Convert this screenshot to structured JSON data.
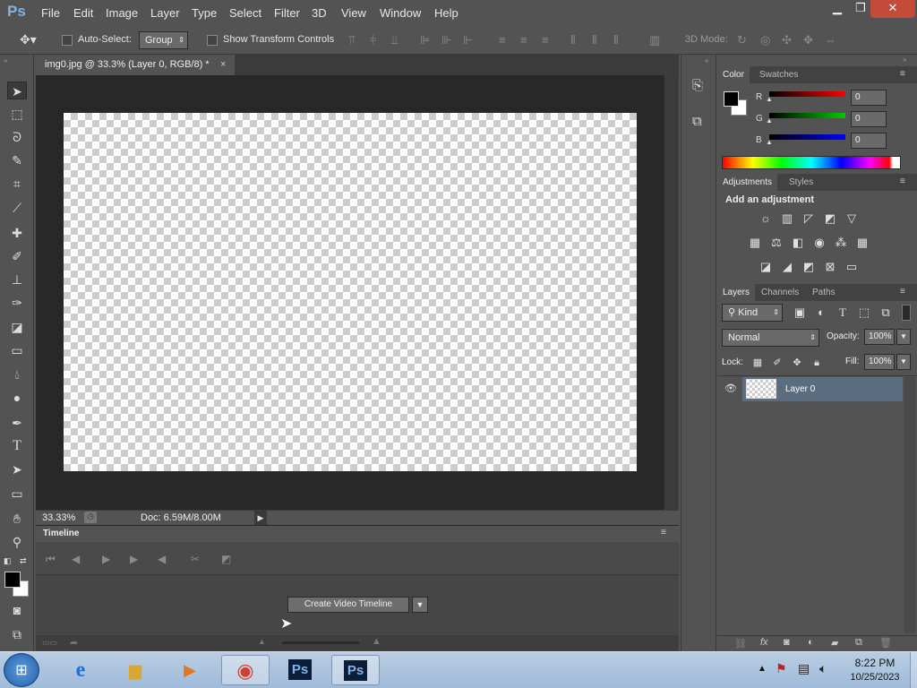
{
  "app": {
    "logo": "Ps",
    "window_controls": {
      "minimize": "▁",
      "restore": "❐",
      "close": "✕"
    }
  },
  "menu": [
    "File",
    "Edit",
    "Image",
    "Layer",
    "Type",
    "Select",
    "Filter",
    "3D",
    "View",
    "Window",
    "Help"
  ],
  "options_bar": {
    "auto_select_label": "Auto-Select:",
    "auto_select_value": "Group",
    "show_transform_label": "Show Transform Controls",
    "mode_3d_label": "3D Mode:"
  },
  "document": {
    "tab_title": "img0.jpg @ 33.3% (Layer 0, RGB/8) *",
    "tab_close": "×",
    "zoom": "33.33%",
    "doc_info": "Doc: 6.59M/8.00M"
  },
  "timeline": {
    "title": "Timeline",
    "create_button": "Create Video Timeline"
  },
  "color_panel": {
    "tabs": [
      "Color",
      "Swatches"
    ],
    "r_label": "R",
    "g_label": "G",
    "b_label": "B",
    "r": "0",
    "g": "0",
    "b": "0"
  },
  "adjustments_panel": {
    "tabs": [
      "Adjustments",
      "Styles"
    ],
    "heading": "Add an adjustment"
  },
  "layers_panel": {
    "tabs": [
      "Layers",
      "Channels",
      "Paths"
    ],
    "filter_kind": "Kind",
    "blend_mode": "Normal",
    "opacity_label": "Opacity:",
    "opacity": "100%",
    "lock_label": "Lock:",
    "fill_label": "Fill:",
    "fill": "100%",
    "layers": [
      {
        "name": "Layer 0"
      }
    ]
  },
  "taskbar": {
    "time": "8:22 PM",
    "date": "10/25/2023"
  },
  "colors": {
    "panel": "#535353",
    "canvas_bg": "#282828",
    "selected_layer": "#5b6d80",
    "taskbar": "#a9c2de"
  }
}
